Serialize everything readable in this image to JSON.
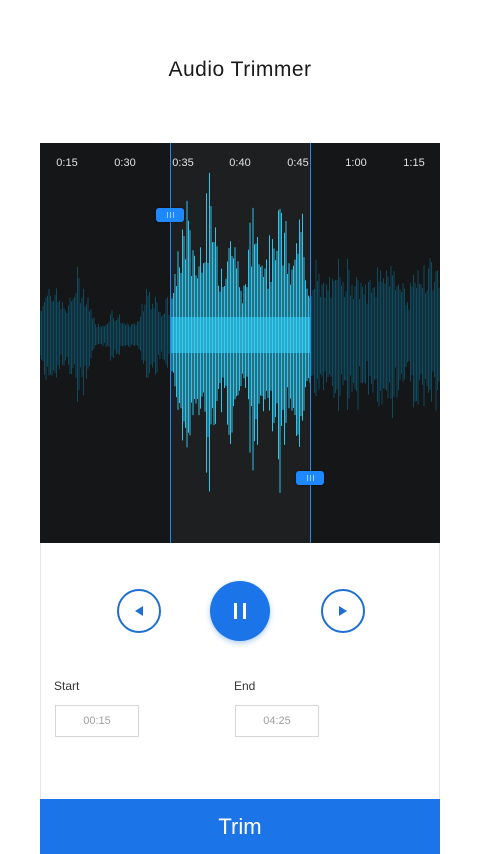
{
  "header": {
    "title": "Audio Trimmer"
  },
  "timeline": {
    "ticks": [
      "0:15",
      "0:30",
      "0:35",
      "0:40",
      "0:45",
      "1:00",
      "1:15"
    ],
    "colors": {
      "background": "#151618",
      "wave_dim": "#0f5870",
      "wave_active": "#2ad3ff",
      "marker": "#1e88ff"
    }
  },
  "player": {
    "prev_icon": "rewind-triangle-icon",
    "pause_icon": "pause-icon",
    "next_icon": "forward-triangle-icon"
  },
  "range": {
    "start_label": "Start",
    "start_value": "00:15",
    "end_label": "End",
    "end_value": "04:25"
  },
  "actions": {
    "trim_label": "Trim",
    "accent": "#1b74e8"
  }
}
